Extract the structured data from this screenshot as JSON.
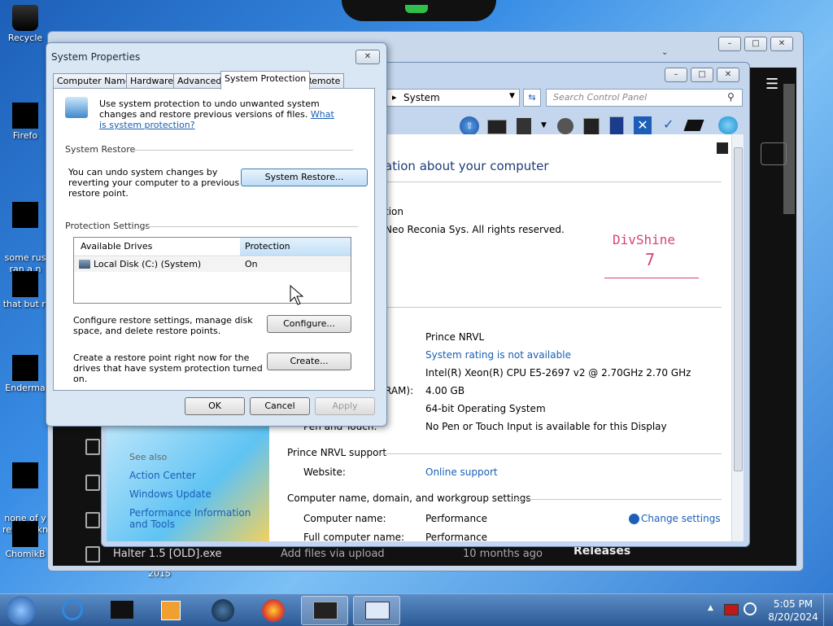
{
  "desktop": {
    "icons": [
      {
        "label": "Recycle",
        "icon": "recycle-bin-icon"
      },
      {
        "label": "Firefo",
        "icon": "firefox-icon"
      },
      {
        "label": "some rus\nran a n",
        "icon": "file-icon"
      },
      {
        "label": "that but n",
        "icon": "file-icon"
      },
      {
        "label": "Enderma",
        "icon": "app-icon"
      },
      {
        "label": "none of y\nretards kn",
        "icon": "file-icon"
      },
      {
        "label": "ChomikB",
        "icon": "app-icon"
      }
    ],
    "stray_text": "2015"
  },
  "browser": {
    "rows": [
      {
        "name": "Halter 1.5 [OLD].exe",
        "message": "Add files via upload",
        "time": "10 months ago"
      }
    ],
    "releases_label": "Releases"
  },
  "control_panel": {
    "address": "System",
    "search_placeholder": "Search Control Panel",
    "heading": "ation about your computer",
    "edition_label": "tion",
    "copyright": "Neo Reconia Sys.  All rights reserved.",
    "logo_text": "DivShine",
    "logo_num": "7",
    "system_values": [
      {
        "label": "",
        "value": "Prince NRVL"
      },
      {
        "label": "",
        "value": "System rating is not available",
        "link": true
      },
      {
        "label": "",
        "value": "Intel(R) Xeon(R) CPU E5-2697 v2 @ 2.70GHz   2.70 GHz"
      },
      {
        "label": "RAM):",
        "value": "4.00 GB"
      },
      {
        "label": "",
        "value": "64-bit Operating System"
      },
      {
        "label": "Pen and Touch:",
        "value": "No Pen or Touch Input is available for this Display"
      }
    ],
    "support_title": "Prince NRVL support",
    "website_label": "Website:",
    "website_value": "Online support",
    "name_section": "Computer name, domain, and workgroup settings",
    "computer_name_label": "Computer name:",
    "computer_name_value": "Performance",
    "full_name_label": "Full computer name:",
    "full_name_value": "Performance",
    "change_settings": "Change settings",
    "see_also": "See also",
    "see_also_links": [
      "Action Center",
      "Windows Update",
      "Performance Information and Tools"
    ]
  },
  "dialog": {
    "title": "System Properties",
    "tabs": [
      "Computer Name",
      "Hardware",
      "Advanced",
      "System Protection",
      "Remote"
    ],
    "active_tab": "System Protection",
    "intro": "Use system protection to undo unwanted system changes and restore previous versions of files.",
    "intro_link": "What is system protection?",
    "restore_group": "System Restore",
    "restore_text": "You can undo system changes by reverting your computer to a previous restore point.",
    "restore_button": "System Restore...",
    "protection_group": "Protection Settings",
    "col_drives": "Available Drives",
    "col_protection": "Protection",
    "drive_name": "Local Disk (C:) (System)",
    "drive_protection": "On",
    "configure_text": "Configure restore settings, manage disk space, and delete restore points.",
    "configure_button": "Configure...",
    "create_text": "Create a restore point right now for the drives that have system protection turned on.",
    "create_button": "Create...",
    "ok": "OK",
    "cancel": "Cancel",
    "apply": "Apply"
  },
  "taskbar": {
    "time": "5:05 PM",
    "date": "8/20/2024"
  }
}
